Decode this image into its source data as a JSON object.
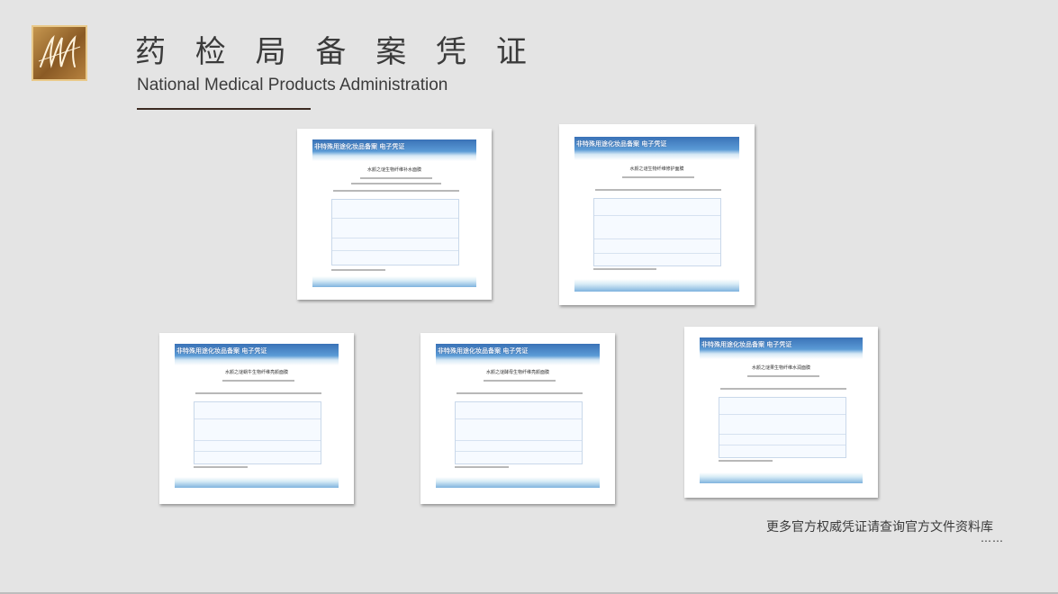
{
  "header": {
    "title_cn": "药 检 局 备 案 凭 证",
    "title_en": "National Medical Products Administration",
    "logo_icon": "monogram-logo-icon"
  },
  "certificates": [
    {
      "banner": "非特殊用途化妆品备案 电子凭证",
      "doc_title": "水颜之谜生物纤维补水面膜"
    },
    {
      "banner": "非特殊用途化妆品备案 电子凭证",
      "doc_title": "水颜之谜生物纤维修护面膜"
    },
    {
      "banner": "非特殊用途化妆品备案 电子凭证",
      "doc_title": "水颜之谜蜗牛生物纤维亮颜面膜"
    },
    {
      "banner": "非特殊用途化妆品备案 电子凭证",
      "doc_title": "水颜之谜酵母生物纤维亮颜面膜"
    },
    {
      "banner": "非特殊用途化妆品备案 电子凭证",
      "doc_title": "水颜之谜果生物纤维水润面膜"
    }
  ],
  "footer": {
    "more_text": "更多官方权威凭证请查询官方文件资料库",
    "dots": "……"
  },
  "colors": {
    "background": "#e4e4e4",
    "text": "#3b3b3b",
    "banner_blue": "#3a72b7",
    "logo_gold": "#c99a52"
  }
}
